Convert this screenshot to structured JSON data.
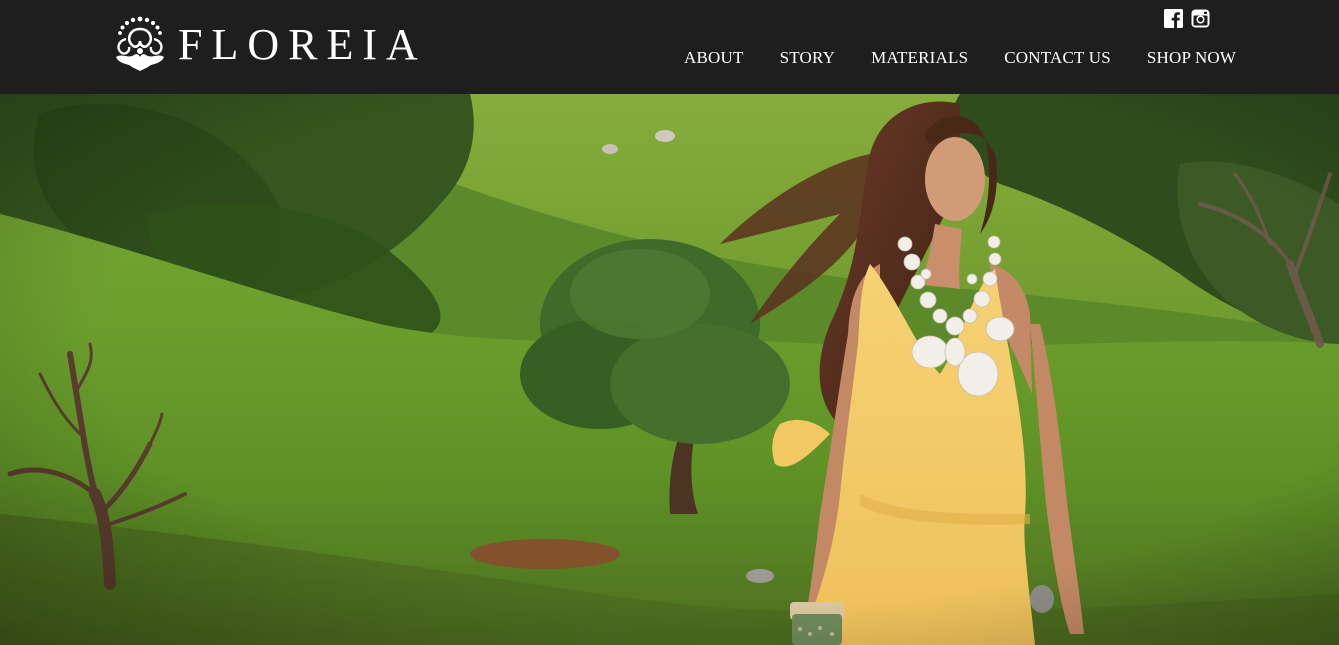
{
  "brand": {
    "name": "FLOREIA",
    "logo_icon": "floreia-ornament-icon"
  },
  "social": {
    "facebook_icon": "facebook-icon",
    "instagram_icon": "instagram-icon"
  },
  "nav": {
    "items": [
      {
        "label": "ABOUT"
      },
      {
        "label": "STORY"
      },
      {
        "label": "MATERIALS"
      },
      {
        "label": "CONTACT US"
      },
      {
        "label": "SHOP NOW"
      }
    ]
  },
  "colors": {
    "header_bg": "#1e1e1e",
    "nav_text": "#ffffff",
    "grass": "#6a9a2e",
    "dress": "#f3c964"
  }
}
